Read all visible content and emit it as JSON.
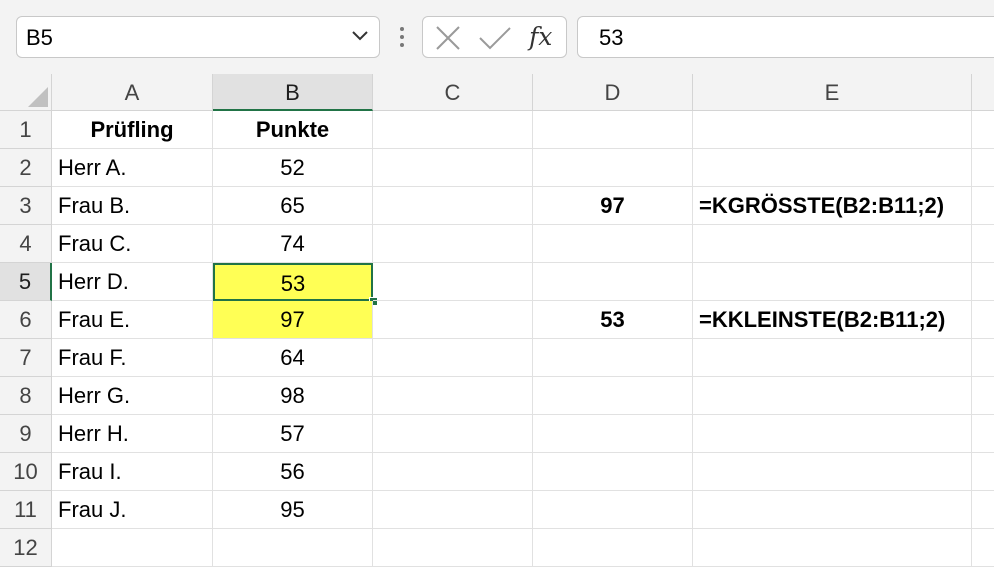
{
  "name_box": {
    "value": "B5"
  },
  "formula_bar": {
    "value": "53"
  },
  "columns": [
    "A",
    "B",
    "C",
    "D",
    "E"
  ],
  "rows": [
    {
      "num": "1",
      "A": "Prüfling",
      "B": "Punkte",
      "D": "",
      "E": ""
    },
    {
      "num": "2",
      "A": "Herr A.",
      "B": "52",
      "D": "",
      "E": ""
    },
    {
      "num": "3",
      "A": "Frau B.",
      "B": "65",
      "D": "97",
      "E": "=KGRÖSSTE(B2:B11;2)"
    },
    {
      "num": "4",
      "A": "Frau C.",
      "B": "74",
      "D": "",
      "E": ""
    },
    {
      "num": "5",
      "A": "Herr D.",
      "B": "53",
      "D": "",
      "E": ""
    },
    {
      "num": "6",
      "A": "Frau E.",
      "B": "97",
      "D": "53",
      "E": "=KKLEINSTE(B2:B11;2)"
    },
    {
      "num": "7",
      "A": "Frau F.",
      "B": "64",
      "D": "",
      "E": ""
    },
    {
      "num": "8",
      "A": "Herr G.",
      "B": "98",
      "D": "",
      "E": ""
    },
    {
      "num": "9",
      "A": "Herr H.",
      "B": "57",
      "D": "",
      "E": ""
    },
    {
      "num": "10",
      "A": "Frau I.",
      "B": "56",
      "D": "",
      "E": ""
    },
    {
      "num": "11",
      "A": "Frau J.",
      "B": "95",
      "D": "",
      "E": ""
    },
    {
      "num": "12",
      "A": "",
      "B": "",
      "D": "",
      "E": ""
    }
  ],
  "highlight_color": "#ffff55",
  "selection_color": "#217346",
  "icons": {
    "name_box_dropdown": "chevron-down-icon",
    "more": "vertical-dots-icon",
    "cancel": "close-icon",
    "enter": "checkmark-icon",
    "function": "fx-icon"
  }
}
